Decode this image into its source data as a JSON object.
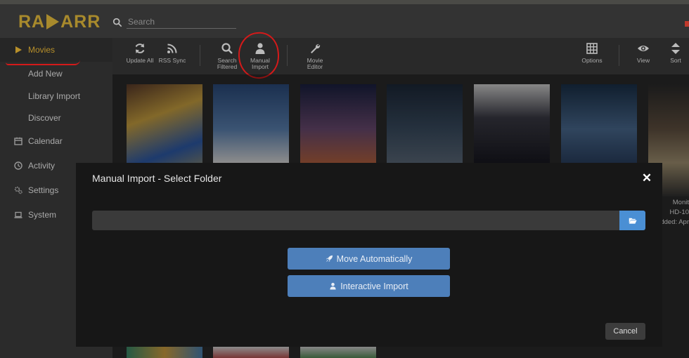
{
  "app": {
    "logo_text_left": "RA",
    "logo_text_right": "ARR"
  },
  "search": {
    "placeholder": "Search"
  },
  "sidebar": {
    "items": [
      {
        "label": "Movies",
        "icon": "play-icon",
        "active": true
      },
      {
        "label": "Add New",
        "sub": true
      },
      {
        "label": "Library Import",
        "sub": true
      },
      {
        "label": "Discover",
        "sub": true
      },
      {
        "label": "Calendar",
        "icon": "calendar-icon"
      },
      {
        "label": "Activity",
        "icon": "clock-icon"
      },
      {
        "label": "Settings",
        "icon": "gears-icon"
      },
      {
        "label": "System",
        "icon": "laptop-icon"
      }
    ]
  },
  "toolbar": {
    "update_all": "Update All",
    "rss_sync": "RSS Sync",
    "search_filtered_1": "Search",
    "search_filtered_2": "Filtered",
    "manual_import_1": "Manual",
    "manual_import_2": "Import",
    "movie_editor_1": "Movie",
    "movie_editor_2": "Editor",
    "options": "Options",
    "view": "View",
    "sort": "Sort"
  },
  "background_card": {
    "line1": "Monit",
    "line2": "HD-10",
    "line3": "dded: Apr"
  },
  "modal": {
    "title": "Manual Import - Select Folder",
    "folder_value": "",
    "move_automatically": "Move Automatically",
    "interactive_import": "Interactive Import",
    "cancel": "Cancel"
  },
  "colors": {
    "brand": "#a88a2c",
    "primary_button": "#4d7fba",
    "folder_button": "#4a8fd4",
    "annotation": "#d41a1a"
  }
}
